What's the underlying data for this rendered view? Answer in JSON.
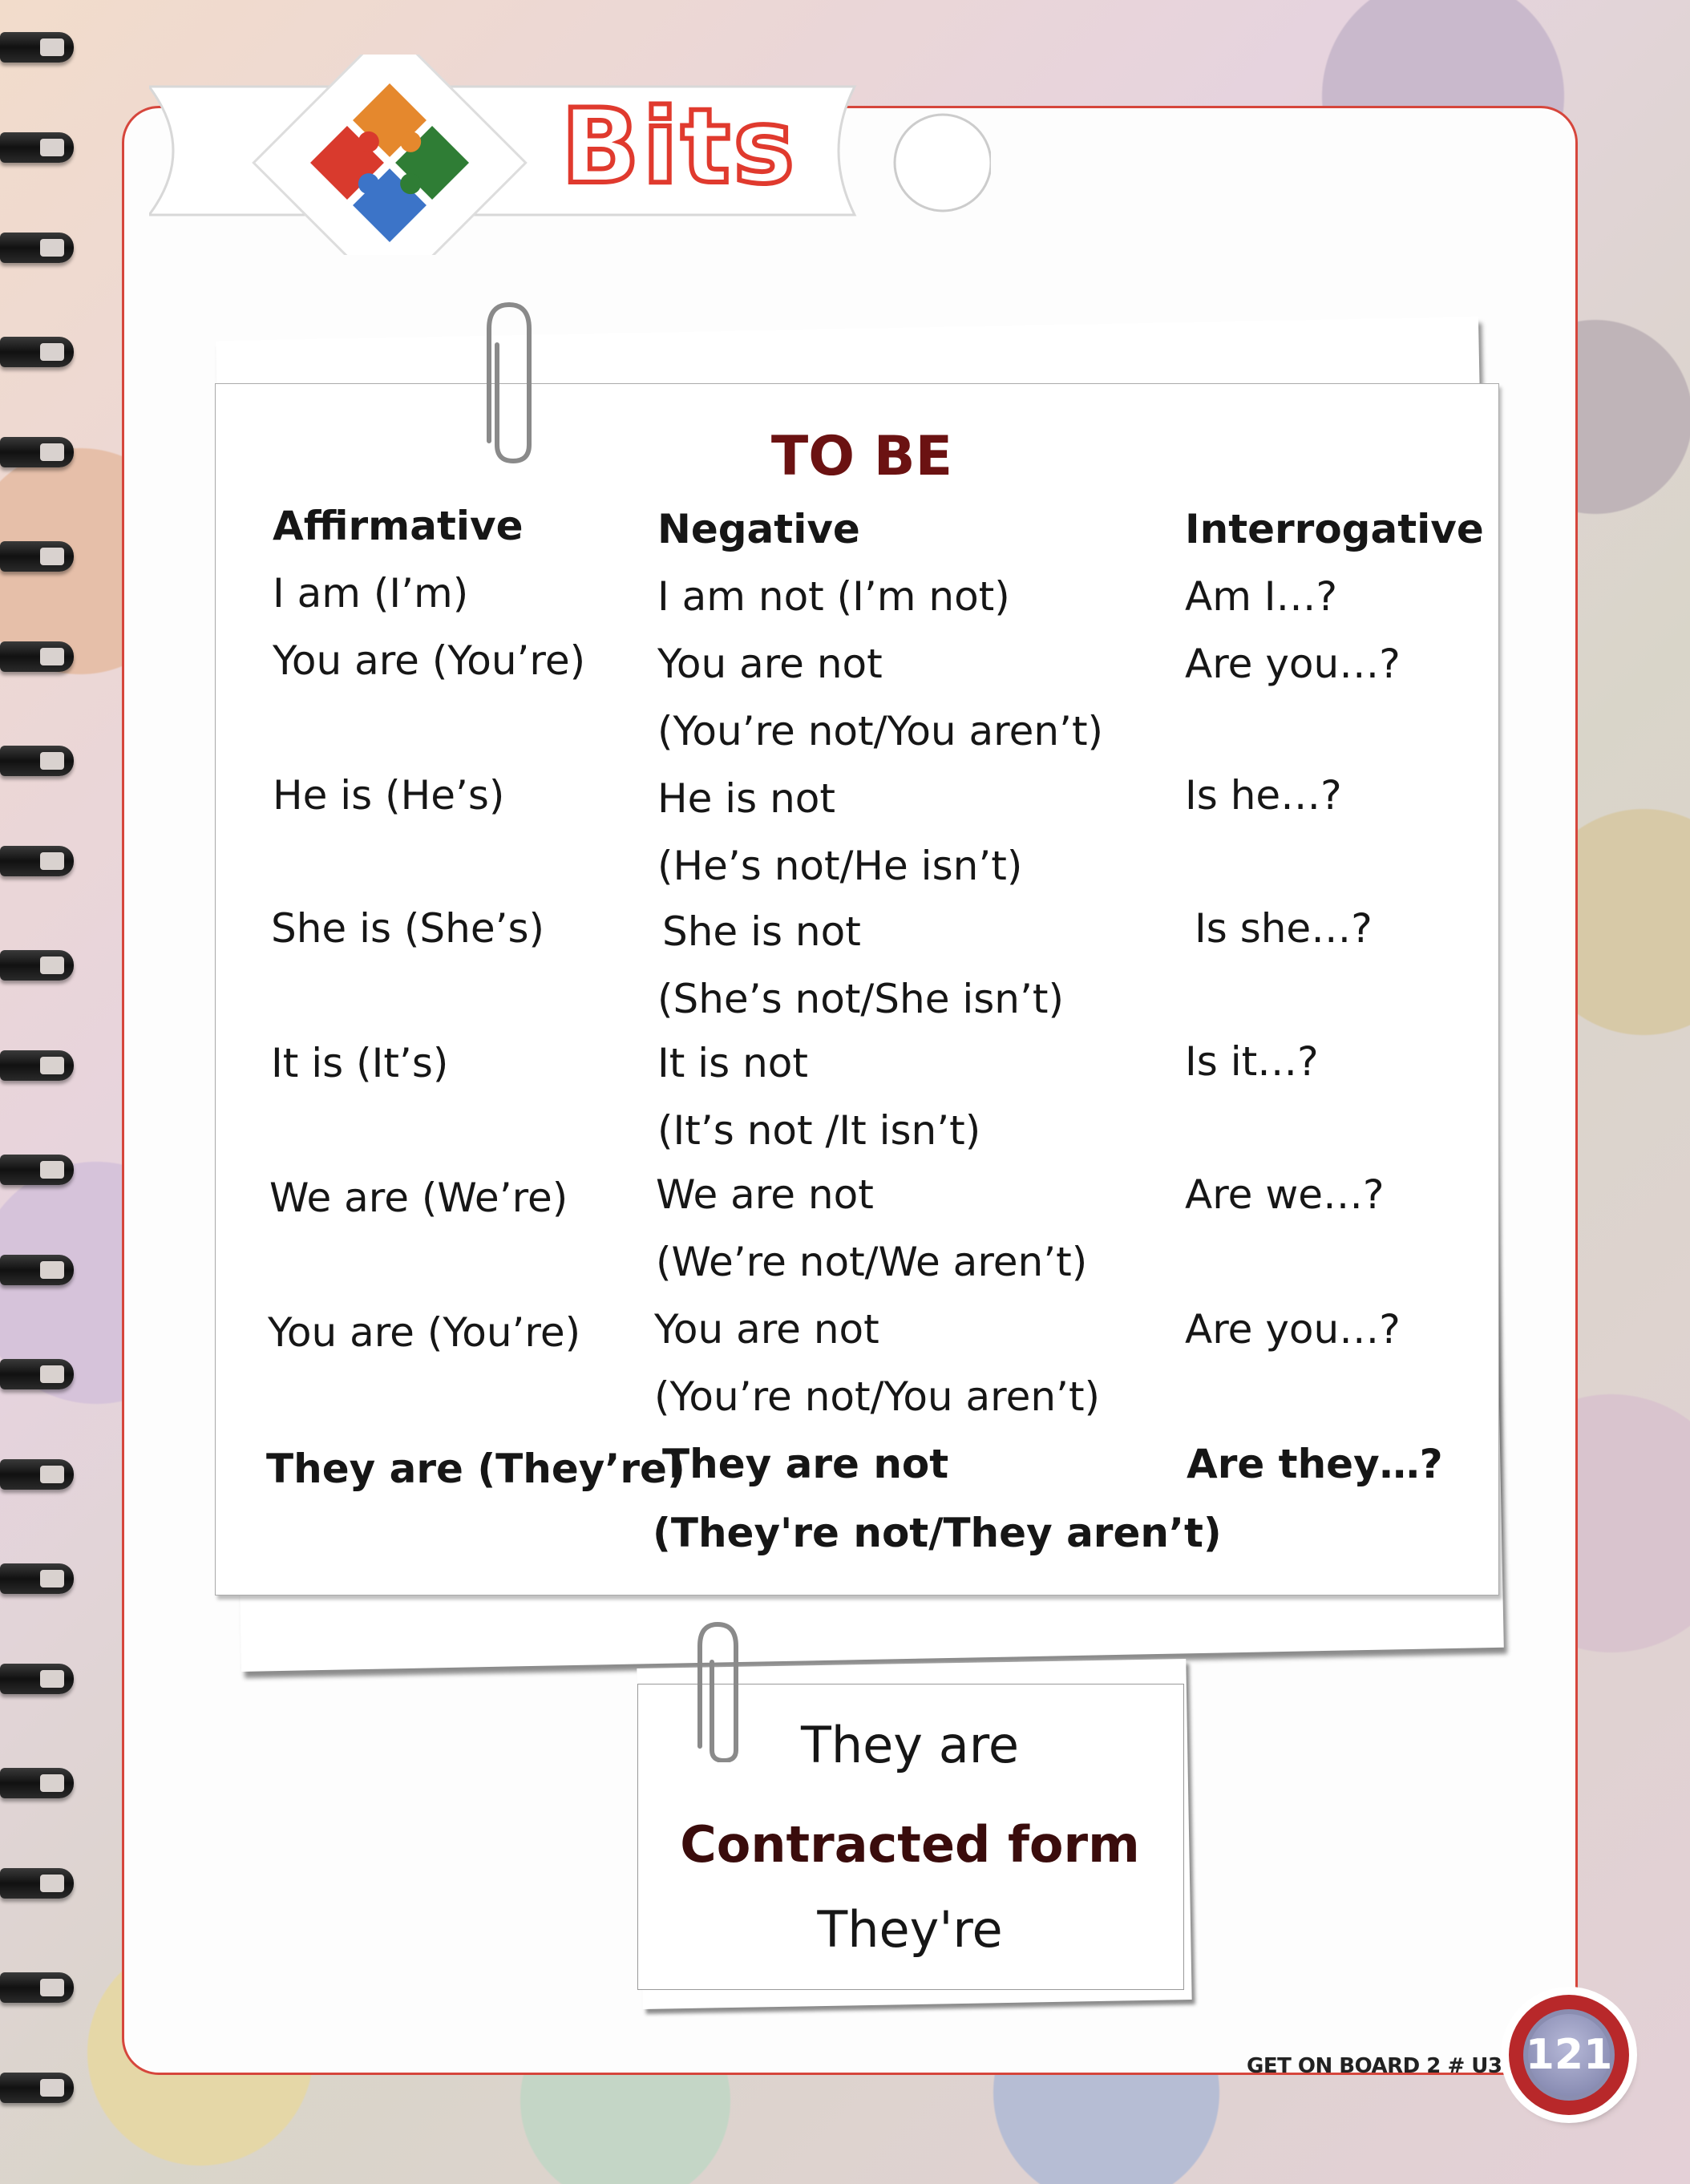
{
  "header": {
    "title": "Bits"
  },
  "table": {
    "title": "TO BE",
    "columns": [
      "Affirmative",
      "Negative",
      "Interrogative"
    ],
    "rows": [
      {
        "affirmative": "I am  (I’m)",
        "negative": [
          "I am not (I’m not)"
        ],
        "interrogative": "Am I…?"
      },
      {
        "affirmative": "You are (You’re)",
        "negative": [
          "You are not",
          "(You’re not/You aren’t)"
        ],
        "interrogative": "Are you…?"
      },
      {
        "affirmative": "He is (He’s)",
        "negative": [
          "He is not",
          "(He’s not/He isn’t)"
        ],
        "interrogative": "Is he…?"
      },
      {
        "affirmative": "She is (She’s)",
        "negative": [
          "She is not",
          "(She’s not/She isn’t)"
        ],
        "interrogative": "Is she…?"
      },
      {
        "affirmative": "It is (It’s)",
        "negative": [
          "It is not",
          "(It’s not /It isn’t)"
        ],
        "interrogative": "Is it…?"
      },
      {
        "affirmative": "We are (We’re)",
        "negative": [
          "We are not",
          "(We’re not/We aren’t)"
        ],
        "interrogative": "Are we…?"
      },
      {
        "affirmative": "You are (You’re)",
        "negative": [
          "You are not",
          "(You’re not/You aren’t)"
        ],
        "interrogative": "Are you…?"
      },
      {
        "affirmative": "They are (They’re)",
        "negative": [
          "They are not",
          "(They're not/They aren’t)"
        ],
        "interrogative": "Are they…?"
      }
    ]
  },
  "note": {
    "line1": "They are",
    "line2": "Contracted form",
    "line3": "They're"
  },
  "footer": {
    "book": "GET ON BOARD 2 # U3 PB",
    "page_number": "121"
  },
  "colors": {
    "accent_red": "#d6463c",
    "heading_maroon": "#6b1212"
  },
  "icons": [
    "puzzle-icon",
    "paperclip-icon"
  ]
}
